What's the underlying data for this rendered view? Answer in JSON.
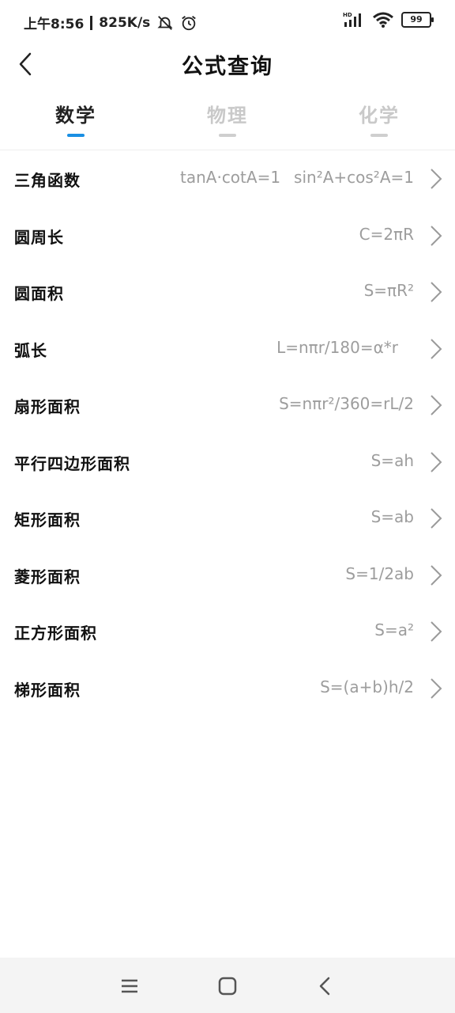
{
  "status": {
    "time": "上午8:56",
    "speed": "825K/s",
    "battery": "99",
    "hd_label": "HD"
  },
  "header": {
    "title": "公式查询"
  },
  "tabs": [
    {
      "label": "数学",
      "active": true
    },
    {
      "label": "物理",
      "active": false
    },
    {
      "label": "化学",
      "active": false
    }
  ],
  "items": [
    {
      "name": "三角函数",
      "formula_a": "tanA·cotA=1",
      "formula": "sin²A+cos²A=1"
    },
    {
      "name": "圆周长",
      "formula": "C=2πR"
    },
    {
      "name": "圆面积",
      "formula": "S=πR²"
    },
    {
      "name": "弧长",
      "formula": "L=nπr/180=α*r"
    },
    {
      "name": "扇形面积",
      "formula": "S=nπr²/360=rL/2"
    },
    {
      "name": "平行四边形面积",
      "formula": "S=ah"
    },
    {
      "name": "矩形面积",
      "formula": "S=ab"
    },
    {
      "name": "菱形面积",
      "formula": "S=1/2ab"
    },
    {
      "name": "正方形面积",
      "formula": "S=a²"
    },
    {
      "name": "梯形面积",
      "formula": "S=(a+b)h/2"
    }
  ],
  "colors": {
    "accent": "#1a8fe3",
    "formula_text": "#9d9d9d",
    "inactive_tab": "#c9c9c9"
  },
  "icons": {
    "back": "back-arrow-icon",
    "chevron": "chevron-right-icon",
    "nav_menu": "menu-icon",
    "nav_home": "home-icon",
    "nav_back": "nav-back-icon"
  }
}
